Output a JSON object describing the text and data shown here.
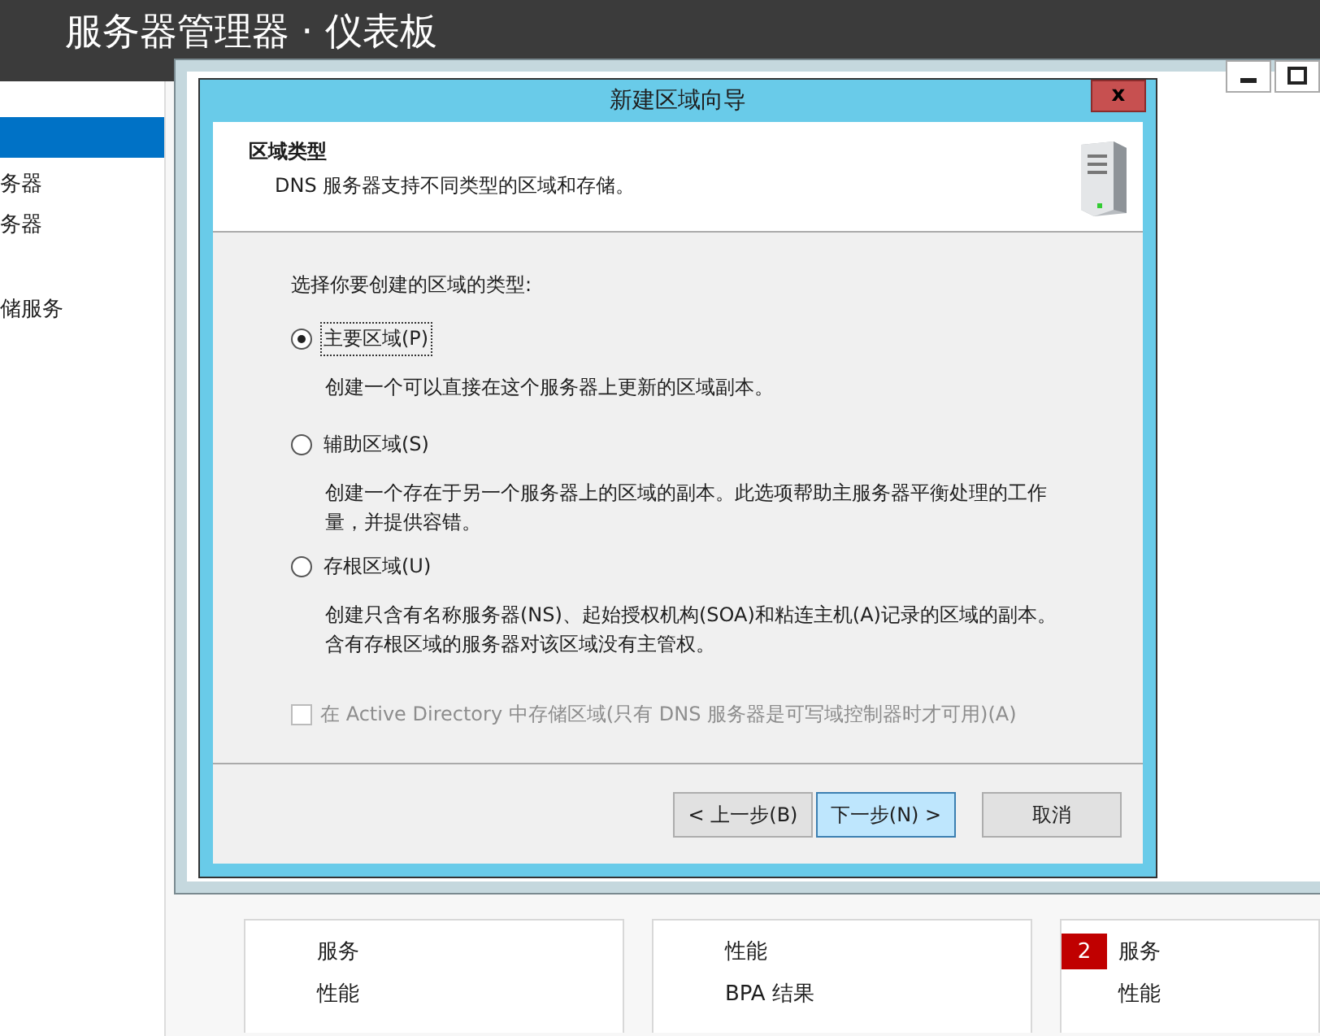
{
  "app": {
    "title": "服务器管理器 · 仪表板"
  },
  "sidebar": {
    "items": [
      {
        "selected": true
      },
      {
        "label": "务器",
        "selected": false
      },
      {
        "label": "务器",
        "selected": false
      },
      {
        "label": "储服务",
        "selected": false
      }
    ]
  },
  "tiles": [
    {
      "items": [
        {
          "label": "服务"
        },
        {
          "label": "性能"
        }
      ]
    },
    {
      "items": [
        {
          "label": "性能"
        },
        {
          "label": "BPA 结果"
        }
      ]
    },
    {
      "items": [
        {
          "label": "服务",
          "badge": "2"
        },
        {
          "label": "性能"
        }
      ]
    }
  ],
  "wizard": {
    "title": "新建区域向导",
    "close": "x",
    "heading": "区域类型",
    "subtitle": "DNS 服务器支持不同类型的区域和存储。",
    "prompt": "选择你要创建的区域的类型:",
    "options": [
      {
        "label": "主要区域(P)",
        "selected": true,
        "description": "创建一个可以直接在这个服务器上更新的区域副本。"
      },
      {
        "label": "辅助区域(S)",
        "selected": false,
        "description": "创建一个存在于另一个服务器上的区域的副本。此选项帮助主服务器平衡处理的工作量，并提供容错。"
      },
      {
        "label": "存根区域(U)",
        "selected": false,
        "description": "创建只含有名称服务器(NS)、起始授权机构(SOA)和粘连主机(A)记录的区域的副本。含有存根区域的服务器对该区域没有主管权。"
      }
    ],
    "ad_checkbox": {
      "label": "在 Active Directory 中存储区域(只有 DNS 服务器是可写域控制器时才可用)(A)",
      "checked": false,
      "disabled": true
    },
    "buttons": [
      {
        "label": "< 上一步(B)",
        "kind": "normal"
      },
      {
        "label": "下一步(N) >",
        "kind": "default"
      },
      {
        "label": "取消",
        "kind": "cancel"
      }
    ]
  }
}
